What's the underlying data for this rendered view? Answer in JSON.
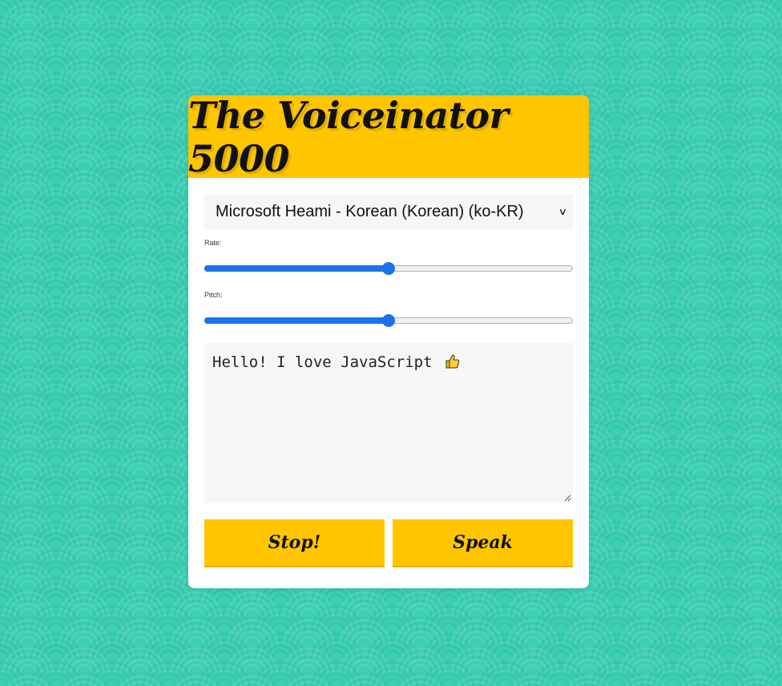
{
  "app": {
    "title": "The Voiceinator 5000"
  },
  "voice_select": {
    "selected": "Microsoft Heami - Korean (Korean) (ko-KR)"
  },
  "rate": {
    "label": "Rate:",
    "value_fraction": 0.5
  },
  "pitch": {
    "label": "Pitch:",
    "value_fraction": 0.5
  },
  "text_input": {
    "value": "Hello! I love JavaScript",
    "emoji_icon": "thumbs-up-icon"
  },
  "buttons": {
    "stop_label": "Stop!",
    "speak_label": "Speak"
  },
  "colors": {
    "background": "#3bcfb4",
    "accent": "#ffc600",
    "slider": "#1a73e8"
  }
}
